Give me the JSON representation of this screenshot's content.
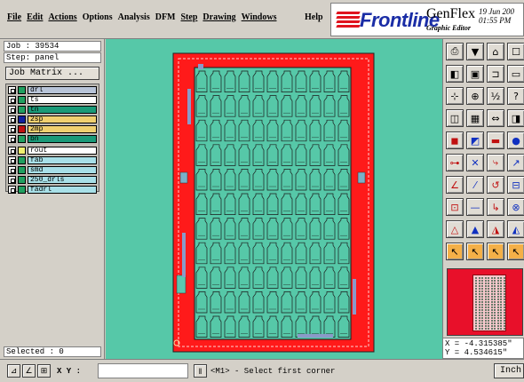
{
  "menu": {
    "items": [
      "File",
      "Edit",
      "Actions",
      "Options",
      "Analysis",
      "DFM",
      "Step",
      "Drawing",
      "Windows"
    ],
    "help": "Help"
  },
  "branding": {
    "logo": "Frontline",
    "product": "GenFlex",
    "subtitle": "Graphic Editor",
    "date": "19 Jun 200",
    "time": "01:55 PM"
  },
  "job": {
    "job_line": "Job : 39534",
    "step_line": "Step: panel",
    "matrix_button": "Job Matrix ..."
  },
  "layers": [
    {
      "name": "drl",
      "color": "#b8c4d8"
    },
    {
      "name": "ts",
      "color": "#ffffff"
    },
    {
      "name": "tn",
      "color": "#1a9a78"
    },
    {
      "name": "2sp",
      "color": "#f0d070"
    },
    {
      "name": "2mp",
      "color": "#f0d070"
    },
    {
      "name": "bn",
      "color": "#1a9a78"
    },
    {
      "name": "rout",
      "color": "#ffffff"
    },
    {
      "name": "fab",
      "color": "#a8e0e8"
    },
    {
      "name": "smd",
      "color": "#a8e0e8"
    },
    {
      "name": "250_drls",
      "color": "#a8e0e8"
    },
    {
      "name": "fadrl",
      "color": "#a8e0e8"
    }
  ],
  "layer_swatches": [
    "#20a060",
    "#20a060",
    "#20a060",
    "#1020a0",
    "#c01010",
    "#20a060",
    "#f0f070",
    "#20a060",
    "#20a060",
    "#20a060",
    "#20a060"
  ],
  "status": {
    "selected": "Selected : 0",
    "xy_label": "X Y :",
    "xy_value": "",
    "prompt": "<M1> - Select first corner",
    "units": "Inch"
  },
  "coordinates": {
    "x": "X = -4.315385\"",
    "y": "Y = 4.534615\""
  },
  "tools": [
    "print-icon",
    "save-icon",
    "home-icon",
    "window-icon",
    "input-icon",
    "output-icon",
    "io-icon",
    "panel-icon",
    "fit-icon",
    "zoom-icon",
    "half-icon",
    "question-icon",
    "layers-icon",
    "grid-icon",
    "mirror-icon",
    "flip-icon",
    "fill-icon",
    "outline-icon",
    "pad-icon",
    "dot-icon",
    "snap-icon",
    "cross-icon",
    "connect-icon",
    "line-icon",
    "angle-icon",
    "slash-icon",
    "arc-icon",
    "bracket-icon",
    "pad-add-icon",
    "dash-icon",
    "corner-icon",
    "move-icon",
    "triangle-icon",
    "triangle2-icon",
    "triangle3-icon",
    "triangle4-icon",
    "pointer-icon",
    "pointer2-icon",
    "pointer3-icon",
    "pointer4-icon"
  ],
  "colors": {
    "canvas": "#56c8a8",
    "panel_red": "#ff1a1a",
    "board_green": "#56c8a8",
    "logo_blue": "#1a2da6"
  }
}
